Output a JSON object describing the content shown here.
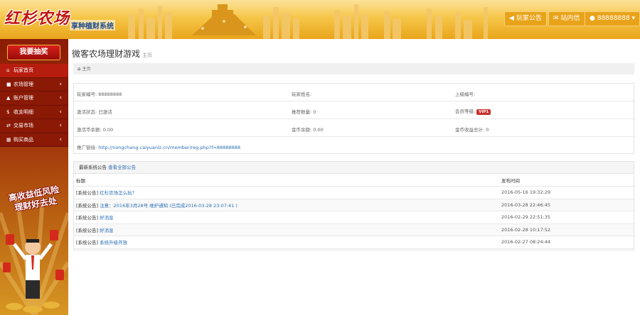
{
  "header": {
    "logo": "红杉农场",
    "subtitle": "享种植财系统",
    "buttons": [
      {
        "icon": "bullhorn-icon",
        "glyph": "◀",
        "label": "玩家公告"
      },
      {
        "icon": "envelope-icon",
        "glyph": "✉",
        "label": "站内信"
      },
      {
        "icon": "user-icon",
        "glyph": "●",
        "label": "88888888 ▾"
      }
    ]
  },
  "sidebar": {
    "lottery": "我要抽奖",
    "items": [
      {
        "glyph": "⌂",
        "label": "玩家首页",
        "chev": ""
      },
      {
        "glyph": "■",
        "label": "农场管理",
        "chev": "‹"
      },
      {
        "glyph": "▲",
        "label": "账户管理",
        "chev": "‹"
      },
      {
        "glyph": "$",
        "label": "收支明细",
        "chev": "‹"
      },
      {
        "glyph": "⇄",
        "label": "交易市场",
        "chev": "‹"
      },
      {
        "glyph": "▦",
        "label": "购买商品",
        "chev": "‹"
      }
    ],
    "promo_line1": "高收益低风险",
    "promo_line2": "理财好去处"
  },
  "main": {
    "title": "微客农场理财游戏",
    "title_small": "主页",
    "breadcrumb": "主页",
    "info": {
      "player_id": "玩家编号: 88888888",
      "player_name": "玩家姓名:",
      "upper_id": "上级编号:",
      "activation": "激活状态: 已激活",
      "recommend": "推荐数量: 0",
      "member_level": "会员等级:",
      "vip": "VIP1",
      "activation_coins": "激活币余额: 0.00",
      "gold_balance": "金币余额: 0.00",
      "gold_total": "金币收益总计: 0",
      "promo_label": "推广链接:",
      "promo_url": "http://nongchang.caiyuanlz.cn/member/reg.php?f=88888888"
    },
    "notices": {
      "head": "最新系统公告",
      "view_all": "查看全部公告",
      "col_title": "标题",
      "col_time": "发布时间",
      "rows": [
        {
          "tag": "[系统公告]",
          "title": "红杉农场怎么玩？",
          "time": "2016-05-16 19:32:29"
        },
        {
          "tag": "[系统公告]",
          "title": "注意：2016年3月28号 维护通知 (已完成2016-03-28 23:07:41 )",
          "time": "2016-03-28 22:46:45"
        },
        {
          "tag": "[系统公告]",
          "title": "好消息",
          "time": "2016-02-29 22:51:35"
        },
        {
          "tag": "[系统公告]",
          "title": "好消息",
          "time": "2016-02-28 10:17:52"
        },
        {
          "tag": "[系统公告]",
          "title": "系统升级开放",
          "time": "2016-02-27 08:24:44"
        }
      ]
    }
  }
}
